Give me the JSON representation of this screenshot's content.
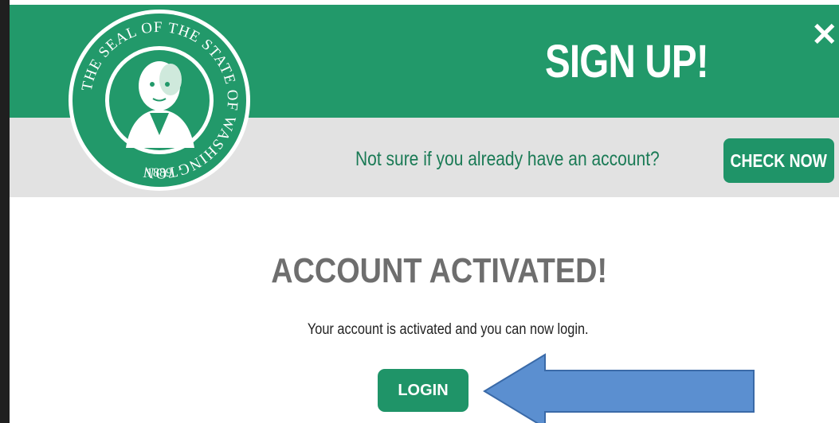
{
  "header": {
    "title": "SIGN UP!",
    "close_glyph": "✕",
    "seal_top_text": "THE SEAL OF THE STATE OF WASHINGTON",
    "seal_year": "1889",
    "brand_color": "#22996a"
  },
  "account_check": {
    "prompt": "Not sure if you already have an account?",
    "button_label": "CHECK NOW"
  },
  "main": {
    "heading": "ACCOUNT ACTIVATED!",
    "message": "Your account is activated and you can now login.",
    "login_label": "LOGIN"
  },
  "annotation": {
    "arrow_color": "#5b8fd0",
    "arrow_icon": "arrow-left-icon"
  }
}
